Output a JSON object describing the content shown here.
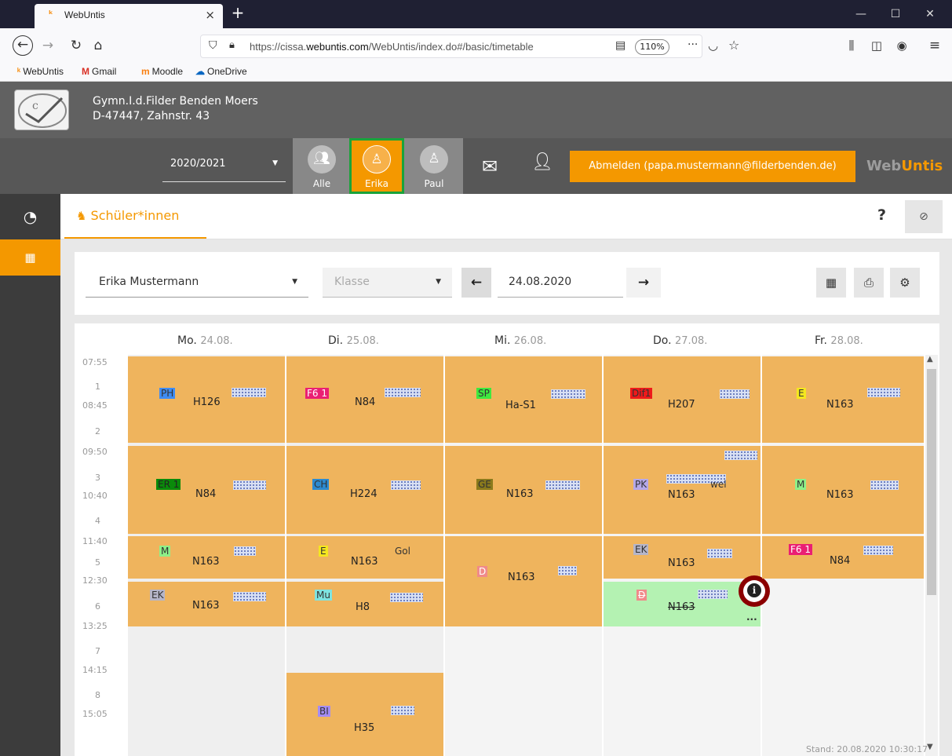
{
  "browser": {
    "tab_title": "WebUntis",
    "tab_close": "×",
    "new_tab": "+",
    "url_prefix": "https://cissa.",
    "url_domain": "webuntis.com",
    "url_suffix": "/WebUntis/index.do#/basic/timetable",
    "zoom": "110%",
    "bookmarks": [
      "WebUntis",
      "Gmail",
      "Moodle",
      "OneDrive"
    ]
  },
  "header": {
    "school_line1": "Gymn.I.d.Filder Benden Moers",
    "school_line2": "D-47447, Zahnstr. 43",
    "school_year": "2020/2021",
    "students": [
      "Alle",
      "Erika",
      "Paul"
    ],
    "logout_label": "Abmelden (papa.mustermann@filderbenden.de)",
    "logo_web": "Web",
    "logo_untis": "Untis"
  },
  "page": {
    "title": "Schüler*innen",
    "help": "?"
  },
  "filters": {
    "student": "Erika Mustermann",
    "class_placeholder": "Klasse",
    "date": "24.08.2020"
  },
  "timetable": {
    "days": [
      {
        "name": "Mo.",
        "date": "24.08."
      },
      {
        "name": "Di.",
        "date": "25.08."
      },
      {
        "name": "Mi.",
        "date": "26.08."
      },
      {
        "name": "Do.",
        "date": "27.08."
      },
      {
        "name": "Fr.",
        "date": "28.08."
      }
    ],
    "time_labels": [
      "07:55",
      "1",
      "08:45",
      "2",
      "09:50",
      "3",
      "10:40",
      "4",
      "11:40",
      "5",
      "12:30",
      "6",
      "13:25",
      "7",
      "14:15",
      "8",
      "15:05"
    ],
    "lessons": {
      "mo1": {
        "subject": "PH",
        "room": "H126"
      },
      "mo2": {
        "subject": "ER 1",
        "room": "N84"
      },
      "mo3": {
        "subject": "M",
        "room": "N163"
      },
      "mo4": {
        "subject": "EK",
        "room": "N163"
      },
      "di1": {
        "subject": "F6 1",
        "room": "N84"
      },
      "di2": {
        "subject": "CH",
        "room": "H224"
      },
      "di3": {
        "subject": "E",
        "room": "N163",
        "teacher": "Gol"
      },
      "di4": {
        "subject": "Mu",
        "room": "H8"
      },
      "di5": {
        "subject": "BI",
        "room": "H35"
      },
      "mi1": {
        "subject": "SP",
        "room": "Ha-S1"
      },
      "mi2": {
        "subject": "GE",
        "room": "N163"
      },
      "mi3": {
        "subject": "D",
        "room": "N163"
      },
      "do1": {
        "subject": "Dif1",
        "room": "H207"
      },
      "do2": {
        "subject": "PK",
        "room": "N163",
        "teacher": "wel"
      },
      "do3": {
        "subject": "EK",
        "room": "N163"
      },
      "do4": {
        "subject": "D",
        "room": "N163",
        "more": "..."
      },
      "fr1": {
        "subject": "E",
        "room": "N163"
      },
      "fr2": {
        "subject": "M",
        "room": "N163"
      },
      "fr3": {
        "subject": "F6 1",
        "room": "N84"
      }
    }
  },
  "footer": {
    "stand": "Stand: 20.08.2020 10:30:17"
  }
}
